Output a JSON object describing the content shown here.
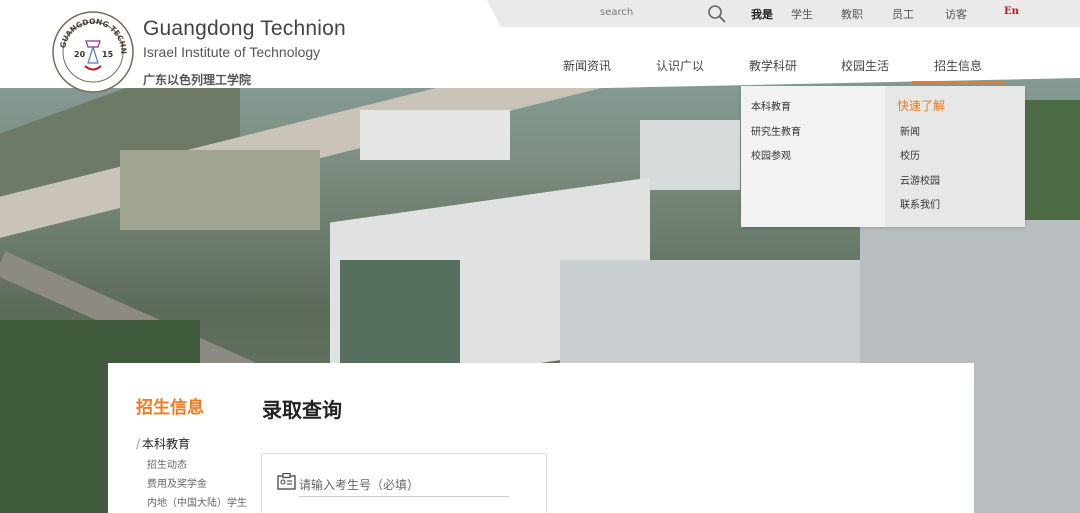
{
  "brand": {
    "name": "Guangdong Technion",
    "sub": "Israel Institute of Technology",
    "cn": "广东以色列理工学院",
    "logo_text": "GUANGDONG TECHNION",
    "logo_year_left": "20",
    "logo_year_right": "15"
  },
  "utility": {
    "search_placeholder": "search",
    "links": [
      "我是",
      "学生",
      "教职",
      "员工",
      "访客",
      "En"
    ]
  },
  "nav": [
    "新闻资讯",
    "认识广以",
    "教学科研",
    "校园生活",
    "招生信息"
  ],
  "dropdown": {
    "col1": [
      "本科教育",
      "研究生教育",
      "校园参观"
    ],
    "col2_head": "快速了解",
    "col2": [
      "新闻",
      "校历",
      "云游校园",
      "联系我们"
    ]
  },
  "sidebar": {
    "title": "招生信息",
    "item": "本科教育",
    "subs": [
      "招生动态",
      "费用及奖学金",
      "内地（中国大陆）学生"
    ]
  },
  "main": {
    "title": "录取查询",
    "input_placeholder": "请输入考生号（必填）"
  },
  "colors": {
    "accent": "#f07a20"
  }
}
